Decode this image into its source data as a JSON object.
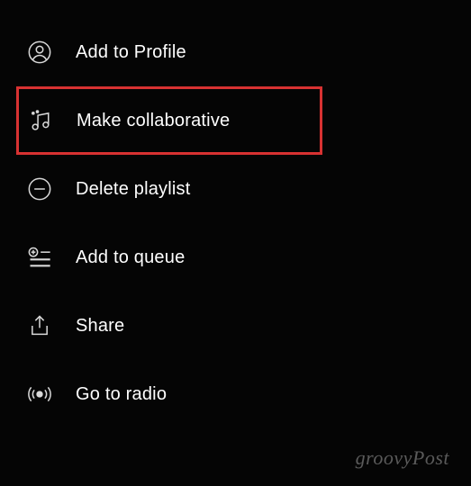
{
  "menu": {
    "items": [
      {
        "label": "Add to Profile",
        "icon": "profile-icon",
        "highlighted": false
      },
      {
        "label": "Make collaborative",
        "icon": "music-note-icon",
        "highlighted": true
      },
      {
        "label": "Delete playlist",
        "icon": "minus-circle-icon",
        "highlighted": false
      },
      {
        "label": "Add to queue",
        "icon": "queue-add-icon",
        "highlighted": false
      },
      {
        "label": "Share",
        "icon": "share-icon",
        "highlighted": false
      },
      {
        "label": "Go to radio",
        "icon": "radio-icon",
        "highlighted": false
      }
    ]
  },
  "watermark": "groovyPost"
}
